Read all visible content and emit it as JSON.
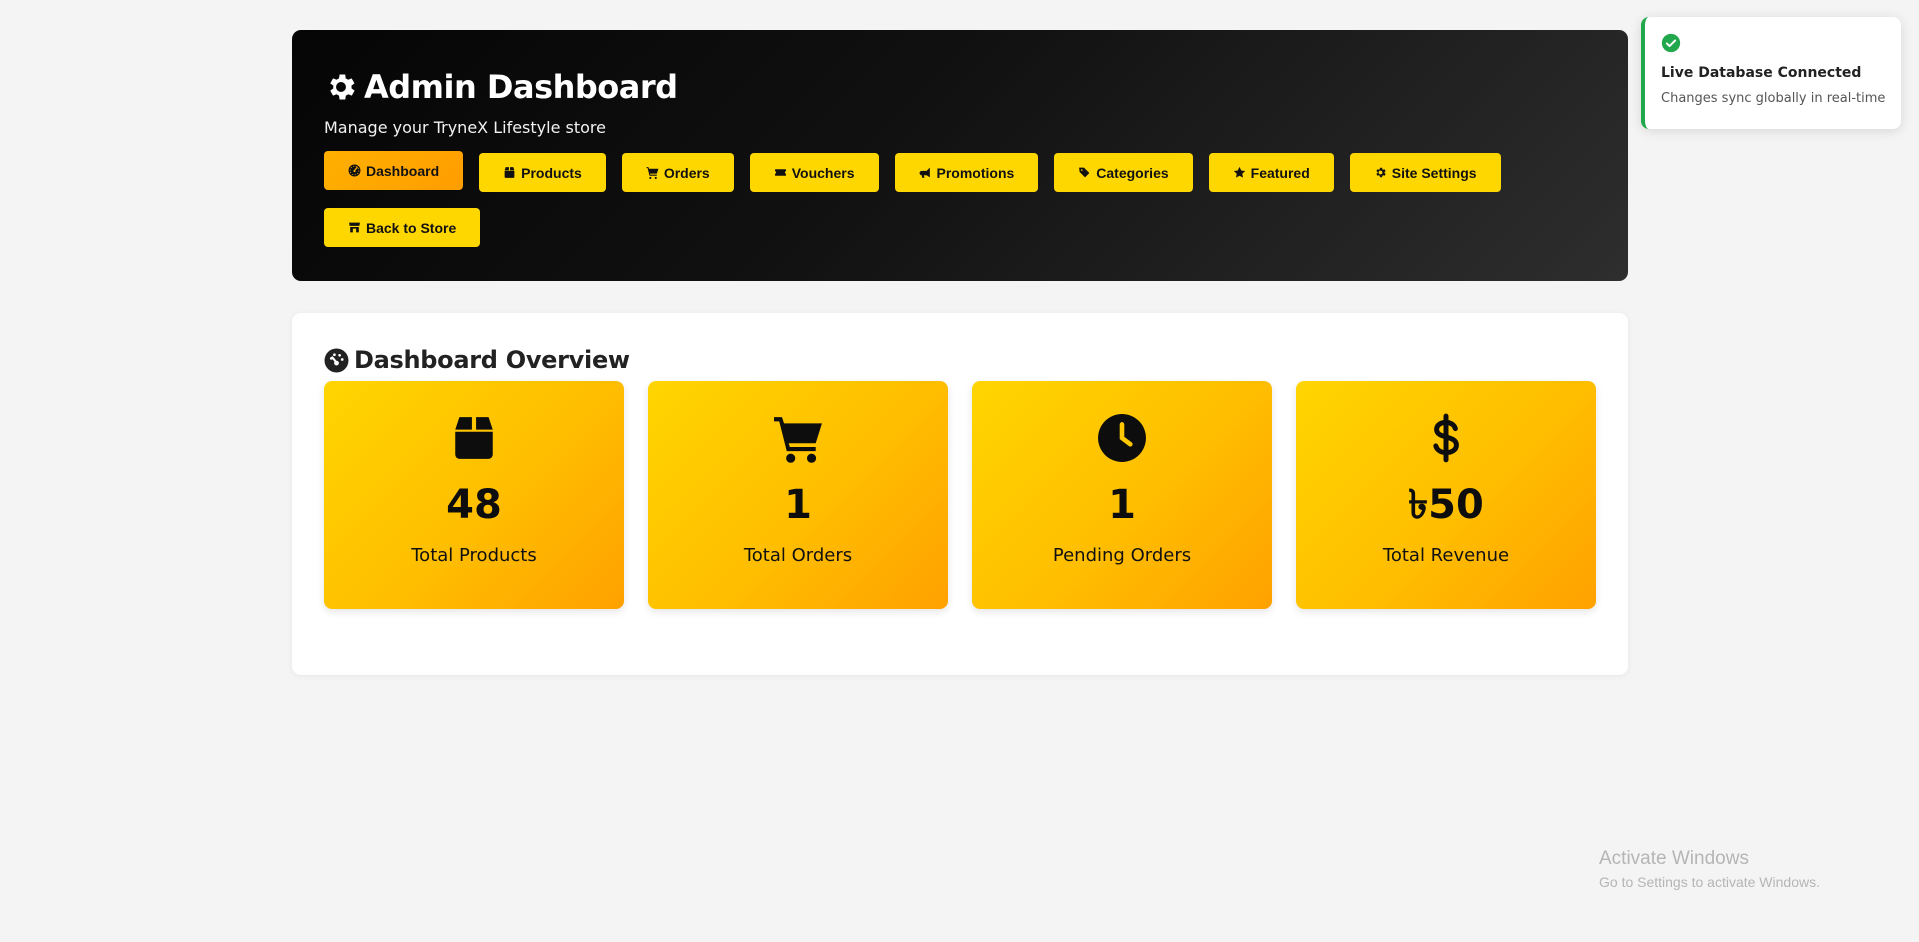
{
  "header": {
    "title": "Admin Dashboard",
    "subtitle": "Manage your TryneX Lifestyle store",
    "nav": [
      {
        "label": "Dashboard",
        "icon": "gauge-icon",
        "active": true
      },
      {
        "label": "Products",
        "icon": "box-icon"
      },
      {
        "label": "Orders",
        "icon": "cart-icon"
      },
      {
        "label": "Vouchers",
        "icon": "ticket-icon"
      },
      {
        "label": "Promotions",
        "icon": "megaphone-icon"
      },
      {
        "label": "Categories",
        "icon": "tags-icon"
      },
      {
        "label": "Featured",
        "icon": "star-icon"
      },
      {
        "label": "Site Settings",
        "icon": "gear-icon"
      },
      {
        "label": "Back to Store",
        "icon": "store-icon"
      }
    ]
  },
  "overview": {
    "title": "Dashboard Overview",
    "cards": [
      {
        "icon": "box-icon",
        "value": "48",
        "label": "Total Products"
      },
      {
        "icon": "cart-icon",
        "value": "1",
        "label": "Total Orders"
      },
      {
        "icon": "clock-icon",
        "value": "1",
        "label": "Pending Orders"
      },
      {
        "icon": "dollar-icon",
        "value": "৳50",
        "label": "Total Revenue"
      }
    ]
  },
  "toast": {
    "title": "Live Database Connected",
    "message": "Changes sync globally in real-time"
  },
  "watermark": {
    "title": "Activate Windows",
    "subtitle": "Go to Settings to activate Windows."
  },
  "colors": {
    "accent": "#ffd700",
    "active": "#ffa500",
    "success": "#22a84c",
    "header_bg": "#0a0a0a"
  }
}
